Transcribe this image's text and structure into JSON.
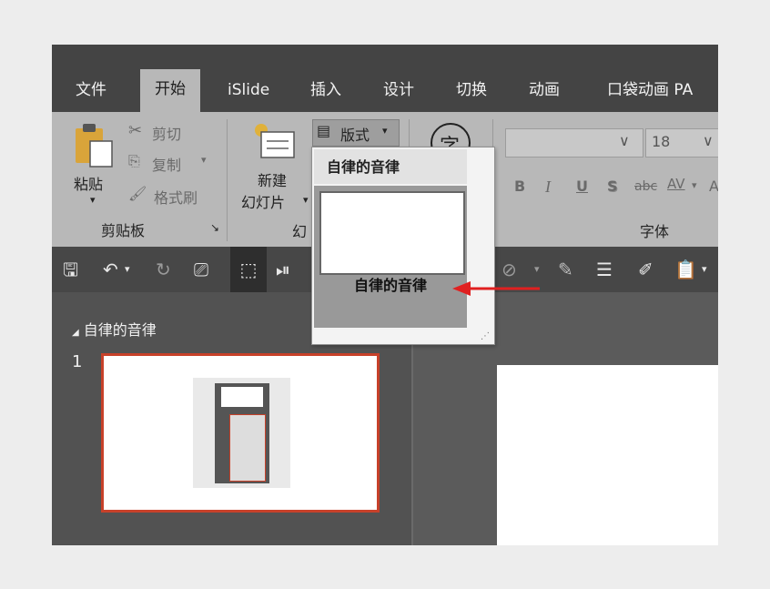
{
  "tabs": [
    "文件",
    "开始",
    "iSlide",
    "插入",
    "设计",
    "切换",
    "动画",
    "口袋动画 PA"
  ],
  "ribbon": {
    "paste_label": "粘贴",
    "cut_label": "剪切",
    "copy_label": "复制",
    "format_painter_label": "格式刷",
    "clipboard_group": "剪贴板",
    "new_slide_line1": "新建",
    "new_slide_line2": "幻灯片",
    "layout_label": "版式",
    "slides_group_partial": "幻",
    "char_icon": "字",
    "font_size": "18",
    "font_group": "字体",
    "bold": "B",
    "italic": "I",
    "underline": "U",
    "shadow": "S",
    "strike": "abc",
    "spacing": "AV",
    "case_partial": "A"
  },
  "layout_dropdown": {
    "header": "自律的音律",
    "item_label": "自律的音律"
  },
  "slide_pane": {
    "section_name": "自律的音律",
    "slide_number": "1"
  },
  "colors": {
    "accent_border": "#c7412a",
    "arrow": "#e02020"
  }
}
